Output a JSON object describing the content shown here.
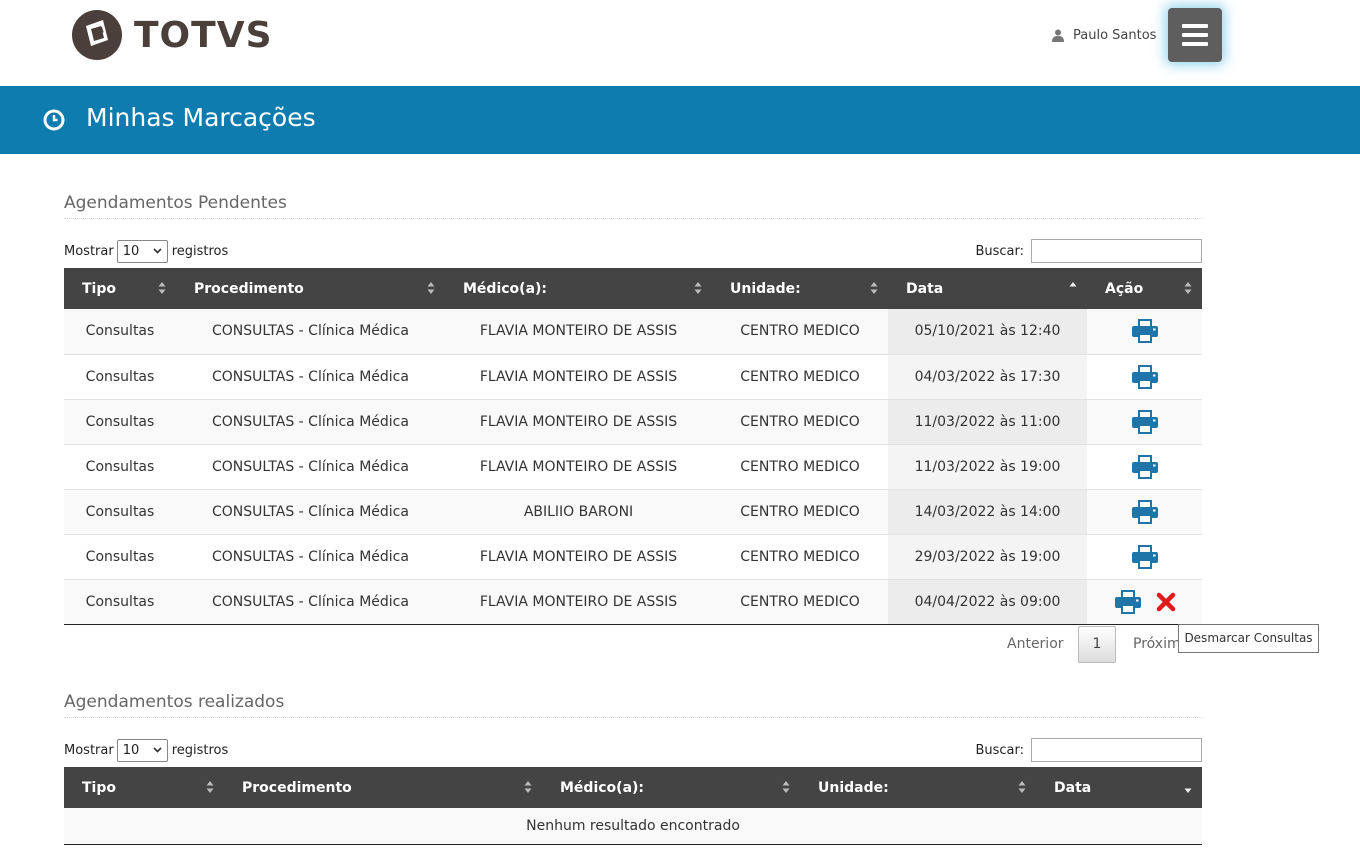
{
  "header": {
    "brand": "TOTVS",
    "user_name": "Paulo Santos"
  },
  "page": {
    "title": "Minhas Marcações"
  },
  "pending": {
    "title": "Agendamentos Pendentes",
    "show_label": "Mostrar",
    "page_size": "10",
    "records_label": "registros",
    "search_label": "Buscar:",
    "search_value": "",
    "columns": [
      "Tipo",
      "Procedimento",
      "Médico(a):",
      "Unidade:",
      "Data",
      "Ação"
    ],
    "rows": [
      {
        "tipo": "Consultas",
        "procedimento": "CONSULTAS - Clínica Médica",
        "medico": "FLAVIA MONTEIRO DE ASSIS",
        "unidade": "CENTRO MEDICO",
        "data": "05/10/2021 às 12:40"
      },
      {
        "tipo": "Consultas",
        "procedimento": "CONSULTAS - Clínica Médica",
        "medico": "FLAVIA MONTEIRO DE ASSIS",
        "unidade": "CENTRO MEDICO",
        "data": "04/03/2022 às 17:30"
      },
      {
        "tipo": "Consultas",
        "procedimento": "CONSULTAS - Clínica Médica",
        "medico": "FLAVIA MONTEIRO DE ASSIS",
        "unidade": "CENTRO MEDICO",
        "data": "11/03/2022 às 11:00"
      },
      {
        "tipo": "Consultas",
        "procedimento": "CONSULTAS - Clínica Médica",
        "medico": "FLAVIA MONTEIRO DE ASSIS",
        "unidade": "CENTRO MEDICO",
        "data": "11/03/2022 às 19:00"
      },
      {
        "tipo": "Consultas",
        "procedimento": "CONSULTAS - Clínica Médica",
        "medico": "ABILIIO BARONI",
        "unidade": "CENTRO MEDICO",
        "data": "14/03/2022 às 14:00"
      },
      {
        "tipo": "Consultas",
        "procedimento": "CONSULTAS - Clínica Médica",
        "medico": "FLAVIA MONTEIRO DE ASSIS",
        "unidade": "CENTRO MEDICO",
        "data": "29/03/2022 às 19:00"
      },
      {
        "tipo": "Consultas",
        "procedimento": "CONSULTAS - Clínica Médica",
        "medico": "FLAVIA MONTEIRO DE ASSIS",
        "unidade": "CENTRO MEDICO",
        "data": "04/04/2022 às 09:00"
      }
    ],
    "pagination": {
      "prev": "Anterior",
      "current": "1",
      "next": "Próxim"
    },
    "tooltip": "Desmarcar Consultas"
  },
  "done": {
    "title": "Agendamentos realizados",
    "show_label": "Mostrar",
    "page_size": "10",
    "records_label": "registros",
    "search_label": "Buscar:",
    "search_value": "",
    "columns": [
      "Tipo",
      "Procedimento",
      "Médico(a):",
      "Unidade:",
      "Data"
    ],
    "empty_message": "Nenhum resultado encontrado"
  },
  "icons": {
    "logo": "totvs-logo-icon",
    "user": "user-icon",
    "menu": "hamburger-menu-icon",
    "title": "clock-icon",
    "print": "printer-icon",
    "cancel": "close-icon"
  },
  "colors": {
    "title_bar": "#0e7cae",
    "table_header": "#444444",
    "print_icon": "#1f75a8",
    "cancel_icon": "#e01b1b"
  }
}
